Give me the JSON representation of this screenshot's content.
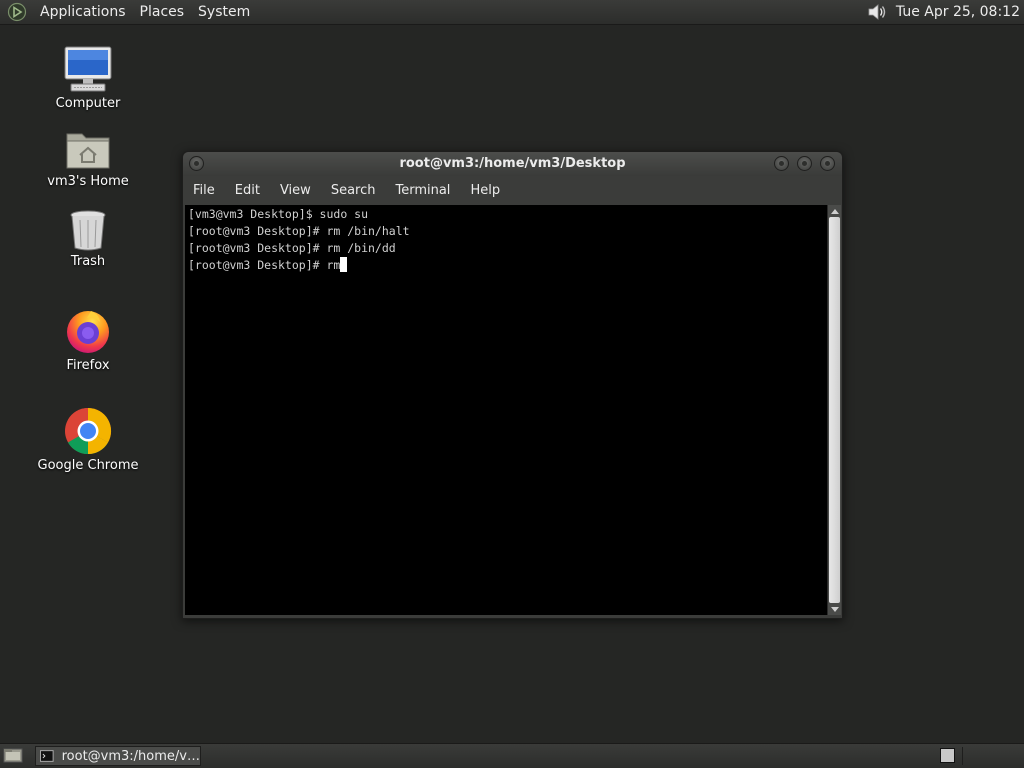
{
  "top_panel": {
    "menus": [
      "Applications",
      "Places",
      "System"
    ],
    "volume_icon": "speaker-icon",
    "clock": "Tue Apr 25, 08:12"
  },
  "desktop_icons": [
    {
      "label": "Computer",
      "icon": "computer-icon"
    },
    {
      "label": "vm3's Home",
      "icon": "home-folder-icon"
    },
    {
      "label": "Trash",
      "icon": "trash-icon"
    },
    {
      "label": "Firefox",
      "icon": "firefox-icon"
    },
    {
      "label": "Google Chrome",
      "icon": "chrome-icon"
    }
  ],
  "terminal": {
    "title": "root@vm3:/home/vm3/Desktop",
    "menus": [
      "File",
      "Edit",
      "View",
      "Search",
      "Terminal",
      "Help"
    ],
    "lines": [
      "[vm3@vm3 Desktop]$ sudo su",
      "[root@vm3 Desktop]# rm /bin/halt",
      "[root@vm3 Desktop]# rm /bin/dd",
      "[root@vm3 Desktop]# rm"
    ]
  },
  "bottom_panel": {
    "task_label": "root@vm3:/home/v…"
  },
  "colors": {
    "desktop_bg": "#252624",
    "panel_bg": "#333432",
    "terminal_bg": "#000000",
    "terminal_fg": "#d0d0d0"
  }
}
